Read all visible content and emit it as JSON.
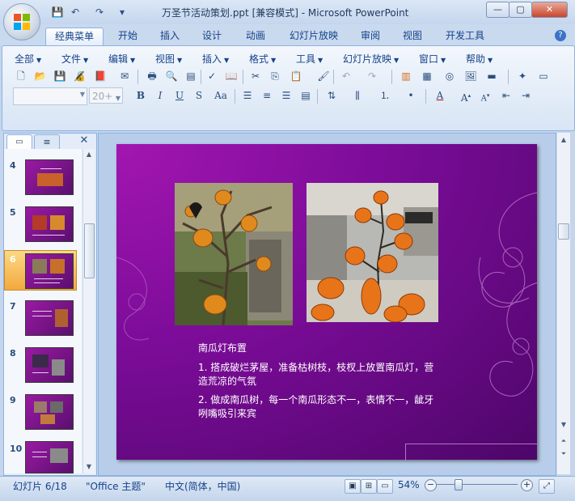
{
  "window": {
    "title": "万圣节活动策划.ppt [兼容模式] - Microsoft PowerPoint",
    "minimize": "—",
    "maximize": "▢",
    "close": "✕"
  },
  "qat": {
    "save_icon": "💾",
    "undo_icon": "↶",
    "redo_icon": "↷",
    "more_icon": "▾"
  },
  "ribbon_tabs": [
    "经典菜单",
    "开始",
    "插入",
    "设计",
    "动画",
    "幻灯片放映",
    "审阅",
    "视图",
    "开发工具"
  ],
  "active_tab": "经典菜单",
  "help_icon": "?",
  "menus": [
    "全部",
    "文件",
    "编辑",
    "视图",
    "插入",
    "格式",
    "工具",
    "幻灯片放映",
    "窗口",
    "帮助"
  ],
  "toolbar": {
    "font_name": "",
    "font_size": "20+",
    "row1_icons": [
      "new-file-icon",
      "open-folder-icon",
      "save-icon",
      "permission-icon",
      "pdf-icon",
      "email-icon",
      "print-icon",
      "print-preview-icon",
      "spelling-icon",
      "research-icon",
      "cut-icon",
      "copy-icon",
      "paste-icon",
      "format-painter-icon",
      "undo-icon",
      "redo-icon",
      "chart-icon",
      "table-icon",
      "clipart-icon",
      "color-icon",
      "new-slide-icon",
      "layout-icon"
    ],
    "row2_icons": [
      "bold-icon",
      "italic-icon",
      "underline-icon",
      "strikethrough-icon",
      "change-case-icon",
      "align-left-icon",
      "align-center-icon",
      "align-right-icon",
      "justify-icon",
      "text-direction-icon",
      "columns-icon",
      "numbering-icon",
      "bullets-icon",
      "font-color-icon",
      "grow-font-icon",
      "shrink-font-icon",
      "decrease-indent-icon",
      "increase-indent-icon"
    ]
  },
  "left_panel": {
    "tab1_icon": "▭",
    "tab2_icon": "≡",
    "close_icon": "✕",
    "thumbnails": [
      {
        "num": "4",
        "selected": false
      },
      {
        "num": "5",
        "selected": false
      },
      {
        "num": "6",
        "selected": true
      },
      {
        "num": "7",
        "selected": false
      },
      {
        "num": "8",
        "selected": false
      },
      {
        "num": "9",
        "selected": false
      },
      {
        "num": "10",
        "selected": false
      }
    ]
  },
  "slide": {
    "heading": "南瓜灯布置",
    "item1": "1. 搭成破烂茅屋，准备枯树枝，枝杈上放置南瓜灯，营造荒凉的气氛",
    "item2": "2. 做成南瓜树，每一个南瓜形态不一，表情不一，龇牙咧嘴吸引来宾",
    "colors": {
      "bg_light": "#a216b0",
      "bg_dark": "#4d0669",
      "text": "#ffffff"
    }
  },
  "statusbar": {
    "slide_info": "幻灯片 6/18",
    "theme": "\"Office 主题\"",
    "language": "中文(简体，中国)",
    "zoom": "54%",
    "zoom_level": 0.54
  }
}
